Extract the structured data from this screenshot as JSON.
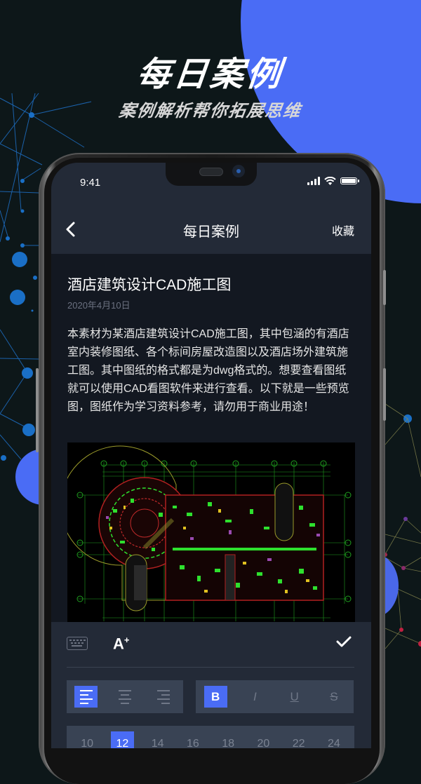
{
  "promo": {
    "title": "每日案例",
    "subtitle": "案例解析帮你拓展思维",
    "accent_color": "#4a6cf5"
  },
  "status_bar": {
    "time": "9:41",
    "icons": [
      "signal-icon",
      "wifi-icon",
      "battery-icon"
    ]
  },
  "nav": {
    "back_icon": "chevron-left-icon",
    "title": "每日案例",
    "favorite_label": "收藏"
  },
  "article": {
    "title": "酒店建筑设计CAD施工图",
    "date": "2020年4月10日",
    "body": "本素材为某酒店建筑设计CAD施工图，其中包涵的有酒店室内装修图纸、各个标间房屋改造图以及酒店场外建筑施工图。其中图纸的格式都是为dwg格式的。想要查看图纸就可以使用CAD看图软件来进行查看。以下就是一些预览图，图纸作为学习资料参考，请勿用于商业用途！",
    "image_alt": "酒店建筑CAD平面图预览"
  },
  "editor": {
    "keyboard_icon": "keyboard-icon",
    "font_size_label": "A",
    "font_size_sup": "+",
    "confirm_icon": "check-icon",
    "align_options": [
      {
        "name": "align-left",
        "active": true
      },
      {
        "name": "align-center",
        "active": false
      },
      {
        "name": "align-right",
        "active": false
      }
    ],
    "style_options": [
      {
        "label": "B",
        "name": "bold",
        "active": true
      },
      {
        "label": "I",
        "name": "italic",
        "active": false
      },
      {
        "label": "U",
        "name": "underline",
        "active": false
      },
      {
        "label": "S",
        "name": "strikethrough",
        "active": false
      }
    ],
    "font_sizes": [
      "10",
      "12",
      "14",
      "16",
      "18",
      "20",
      "22",
      "24"
    ],
    "selected_font_size": "12"
  }
}
